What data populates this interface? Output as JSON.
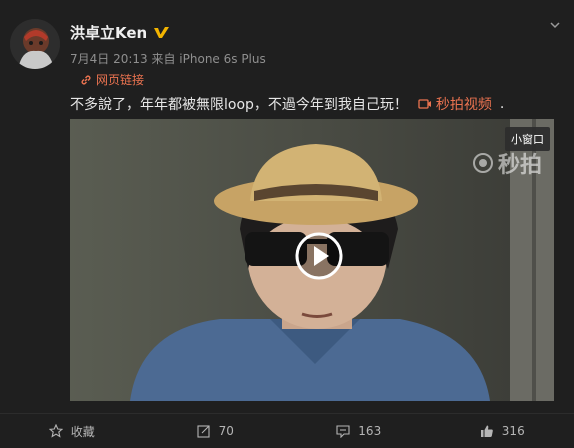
{
  "post": {
    "author": "洪卓立Ken",
    "meta": "7月4日 20:13 来自 iPhone 6s Plus",
    "link_label": "网页链接",
    "text": "不多說了，年年都被無限loop，不過今年到我自己玩！",
    "video_tag": "秒拍视频",
    "trailing": "."
  },
  "video": {
    "mini_window_label": "小窗口",
    "watermark": "秒拍"
  },
  "actions": {
    "favorite_label": "收藏",
    "repost_count": "70",
    "comment_count": "163",
    "like_count": "316"
  },
  "colors": {
    "accent": "#eb7350",
    "verified": "#f2b400"
  }
}
